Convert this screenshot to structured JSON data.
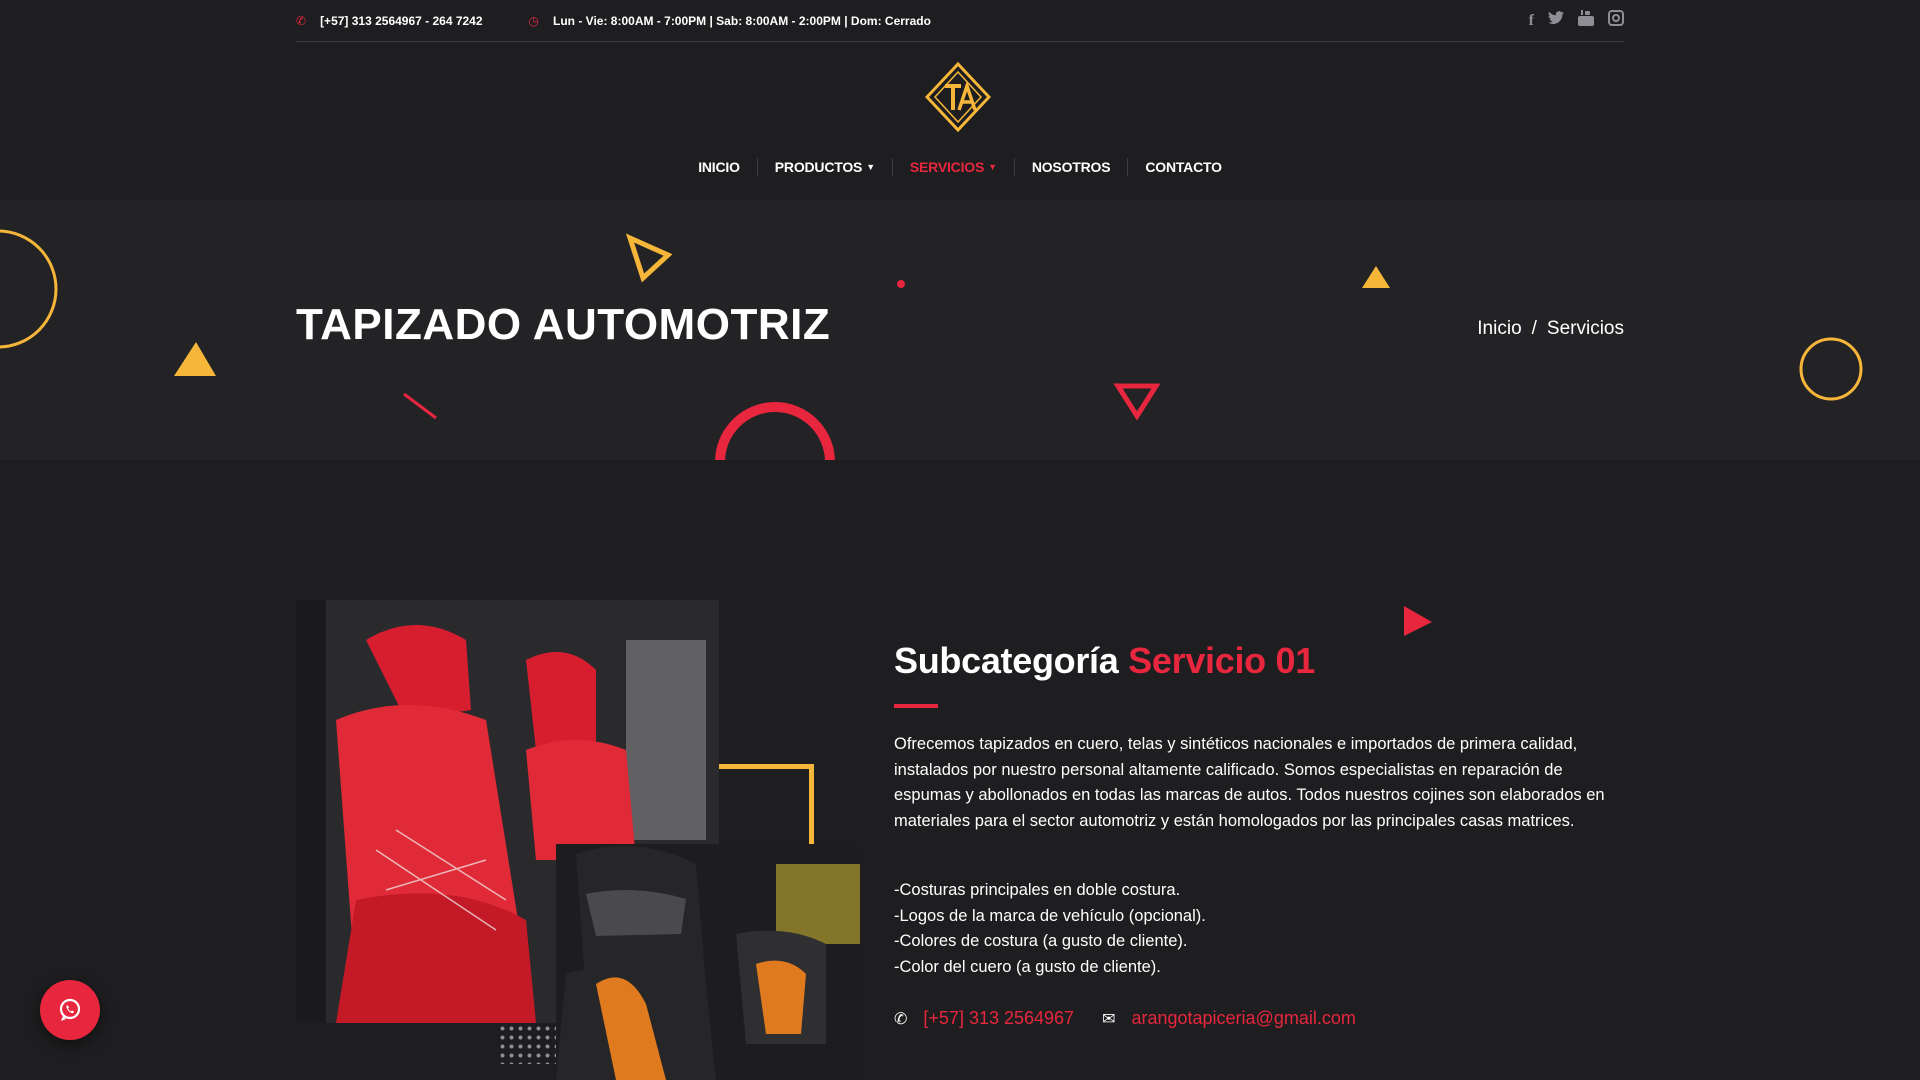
{
  "topbar": {
    "phone": "[+57] 313 2564967 - 264 7242",
    "hours": "Lun - Vie: 8:00AM - 7:00PM | Sab: 8:00AM - 2:00PM | Dom: Cerrado",
    "phone_icon": "phone-icon",
    "clock_icon": "clock-icon",
    "social_icons": [
      "facebook-icon",
      "twitter-icon",
      "youtube-icon",
      "instagram-icon"
    ]
  },
  "logo": {
    "text": "TA"
  },
  "nav": {
    "items": [
      {
        "label": "INICIO",
        "active": false,
        "dropdown": false
      },
      {
        "label": "PRODUCTOS",
        "active": false,
        "dropdown": true
      },
      {
        "label": "SERVICIOS",
        "active": true,
        "dropdown": true
      },
      {
        "label": "NOSOTROS",
        "active": false,
        "dropdown": false
      },
      {
        "label": "CONTACTO",
        "active": false,
        "dropdown": false
      }
    ]
  },
  "banner": {
    "title": "TAPIZADO AUTOMOTRIZ",
    "breadcrumb": {
      "home": "Inicio",
      "separator": "/",
      "current": "Servicios"
    }
  },
  "content": {
    "heading_main": "Subcategoría",
    "heading_accent": "Servicio 01",
    "paragraph": "Ofrecemos tapizados en cuero, telas y sintéticos nacionales e importados de primera calidad, instalados por nuestro personal altamente calificado. Somos especialistas en reparación de espumas y abollonados en todas las marcas de autos. Todos nuestros cojines son elaborados en materiales para el sector automotriz y están homologados por las principales casas matrices.",
    "features": [
      "-Costuras principales en doble costura.",
      "-Logos de la marca de vehículo (opcional).",
      "-Colores de costura (a gusto de cliente).",
      "-Color del cuero (a gusto de cliente)."
    ],
    "contact_phone": "[+57] 313 2564967",
    "contact_email": "arangotapiceria@gmail.com"
  },
  "colors": {
    "accent": "#e8263e",
    "secondary": "#f5b63a",
    "background": "#1e1e20"
  }
}
